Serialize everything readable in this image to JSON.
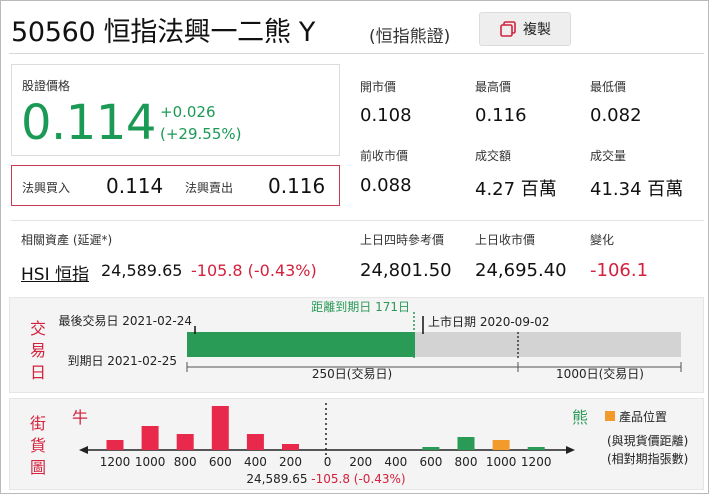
{
  "header": {
    "title": "50560 恒指法興一二熊 Y",
    "subtitle": "(恒指熊證)",
    "copy_label": "複製"
  },
  "price": {
    "label": "股證價格",
    "value": "0.114",
    "change": "+0.026",
    "change_pct": "(+29.55%)"
  },
  "bid_ask": {
    "bid_label": "法興買入",
    "bid": "0.114",
    "ask_label": "法興賣出",
    "ask": "0.116"
  },
  "stats": [
    {
      "label": "開市價",
      "value": "0.108"
    },
    {
      "label": "最高價",
      "value": "0.116"
    },
    {
      "label": "最低價",
      "value": "0.082"
    },
    {
      "label": "前收市價",
      "value": "0.088"
    },
    {
      "label": "成交額",
      "value": "4.27 百萬"
    },
    {
      "label": "成交量",
      "value": "41.34 百萬"
    }
  ],
  "related": {
    "label": "相關資產 (延遲*)",
    "link": "HSI 恒指",
    "price": "24,589.65",
    "change": "-105.8 (-0.43%)",
    "stats": [
      {
        "label": "上日四時參考價",
        "value": "24,801.50"
      },
      {
        "label": "上日收市價",
        "value": "24,695.40"
      },
      {
        "label": "變化",
        "value": "-106.1"
      }
    ]
  },
  "trading_days": {
    "vlabel": [
      "交",
      "易",
      "日"
    ],
    "last_trade": "最後交易日 2021-02-24",
    "expiry": "到期日 2021-02-25",
    "days_to_expiry": "距離到期日 171日",
    "listing": "上市日期 2020-09-02",
    "scale_left": "250日(交易日)",
    "scale_right": "1000日(交易日)",
    "progress": 0.985
  },
  "street": {
    "vlabel": [
      "街",
      "貨",
      "圖"
    ],
    "bull": "牛",
    "bear": "熊",
    "legend_label": "產品位置",
    "note1": "(與現貨價距離)",
    "note2": "(相對期指張數)",
    "center_price": "24,589.65",
    "center_change": "-105.8 (-0.43%)",
    "ticks": [
      "1200",
      "1000",
      "800",
      "600",
      "400",
      "200",
      "0",
      "200",
      "400",
      "600",
      "800",
      "1000",
      "1200"
    ],
    "bull_bars": [
      {
        "level": "1200",
        "height": 10
      },
      {
        "level": "1000",
        "height": 24
      },
      {
        "level": "800",
        "height": 16
      },
      {
        "level": "600",
        "height": 44
      },
      {
        "level": "400",
        "height": 16
      },
      {
        "level": "200",
        "height": 6
      }
    ],
    "bear_bars": [
      {
        "level": "600",
        "height": 3
      },
      {
        "level": "800",
        "height": 13
      },
      {
        "level": "1000",
        "height": 10,
        "product": true
      },
      {
        "level": "1200",
        "height": 3
      }
    ],
    "colors": {
      "bull": "#e8294b",
      "bear": "#2a9a57",
      "product": "#f39a2c"
    }
  }
}
